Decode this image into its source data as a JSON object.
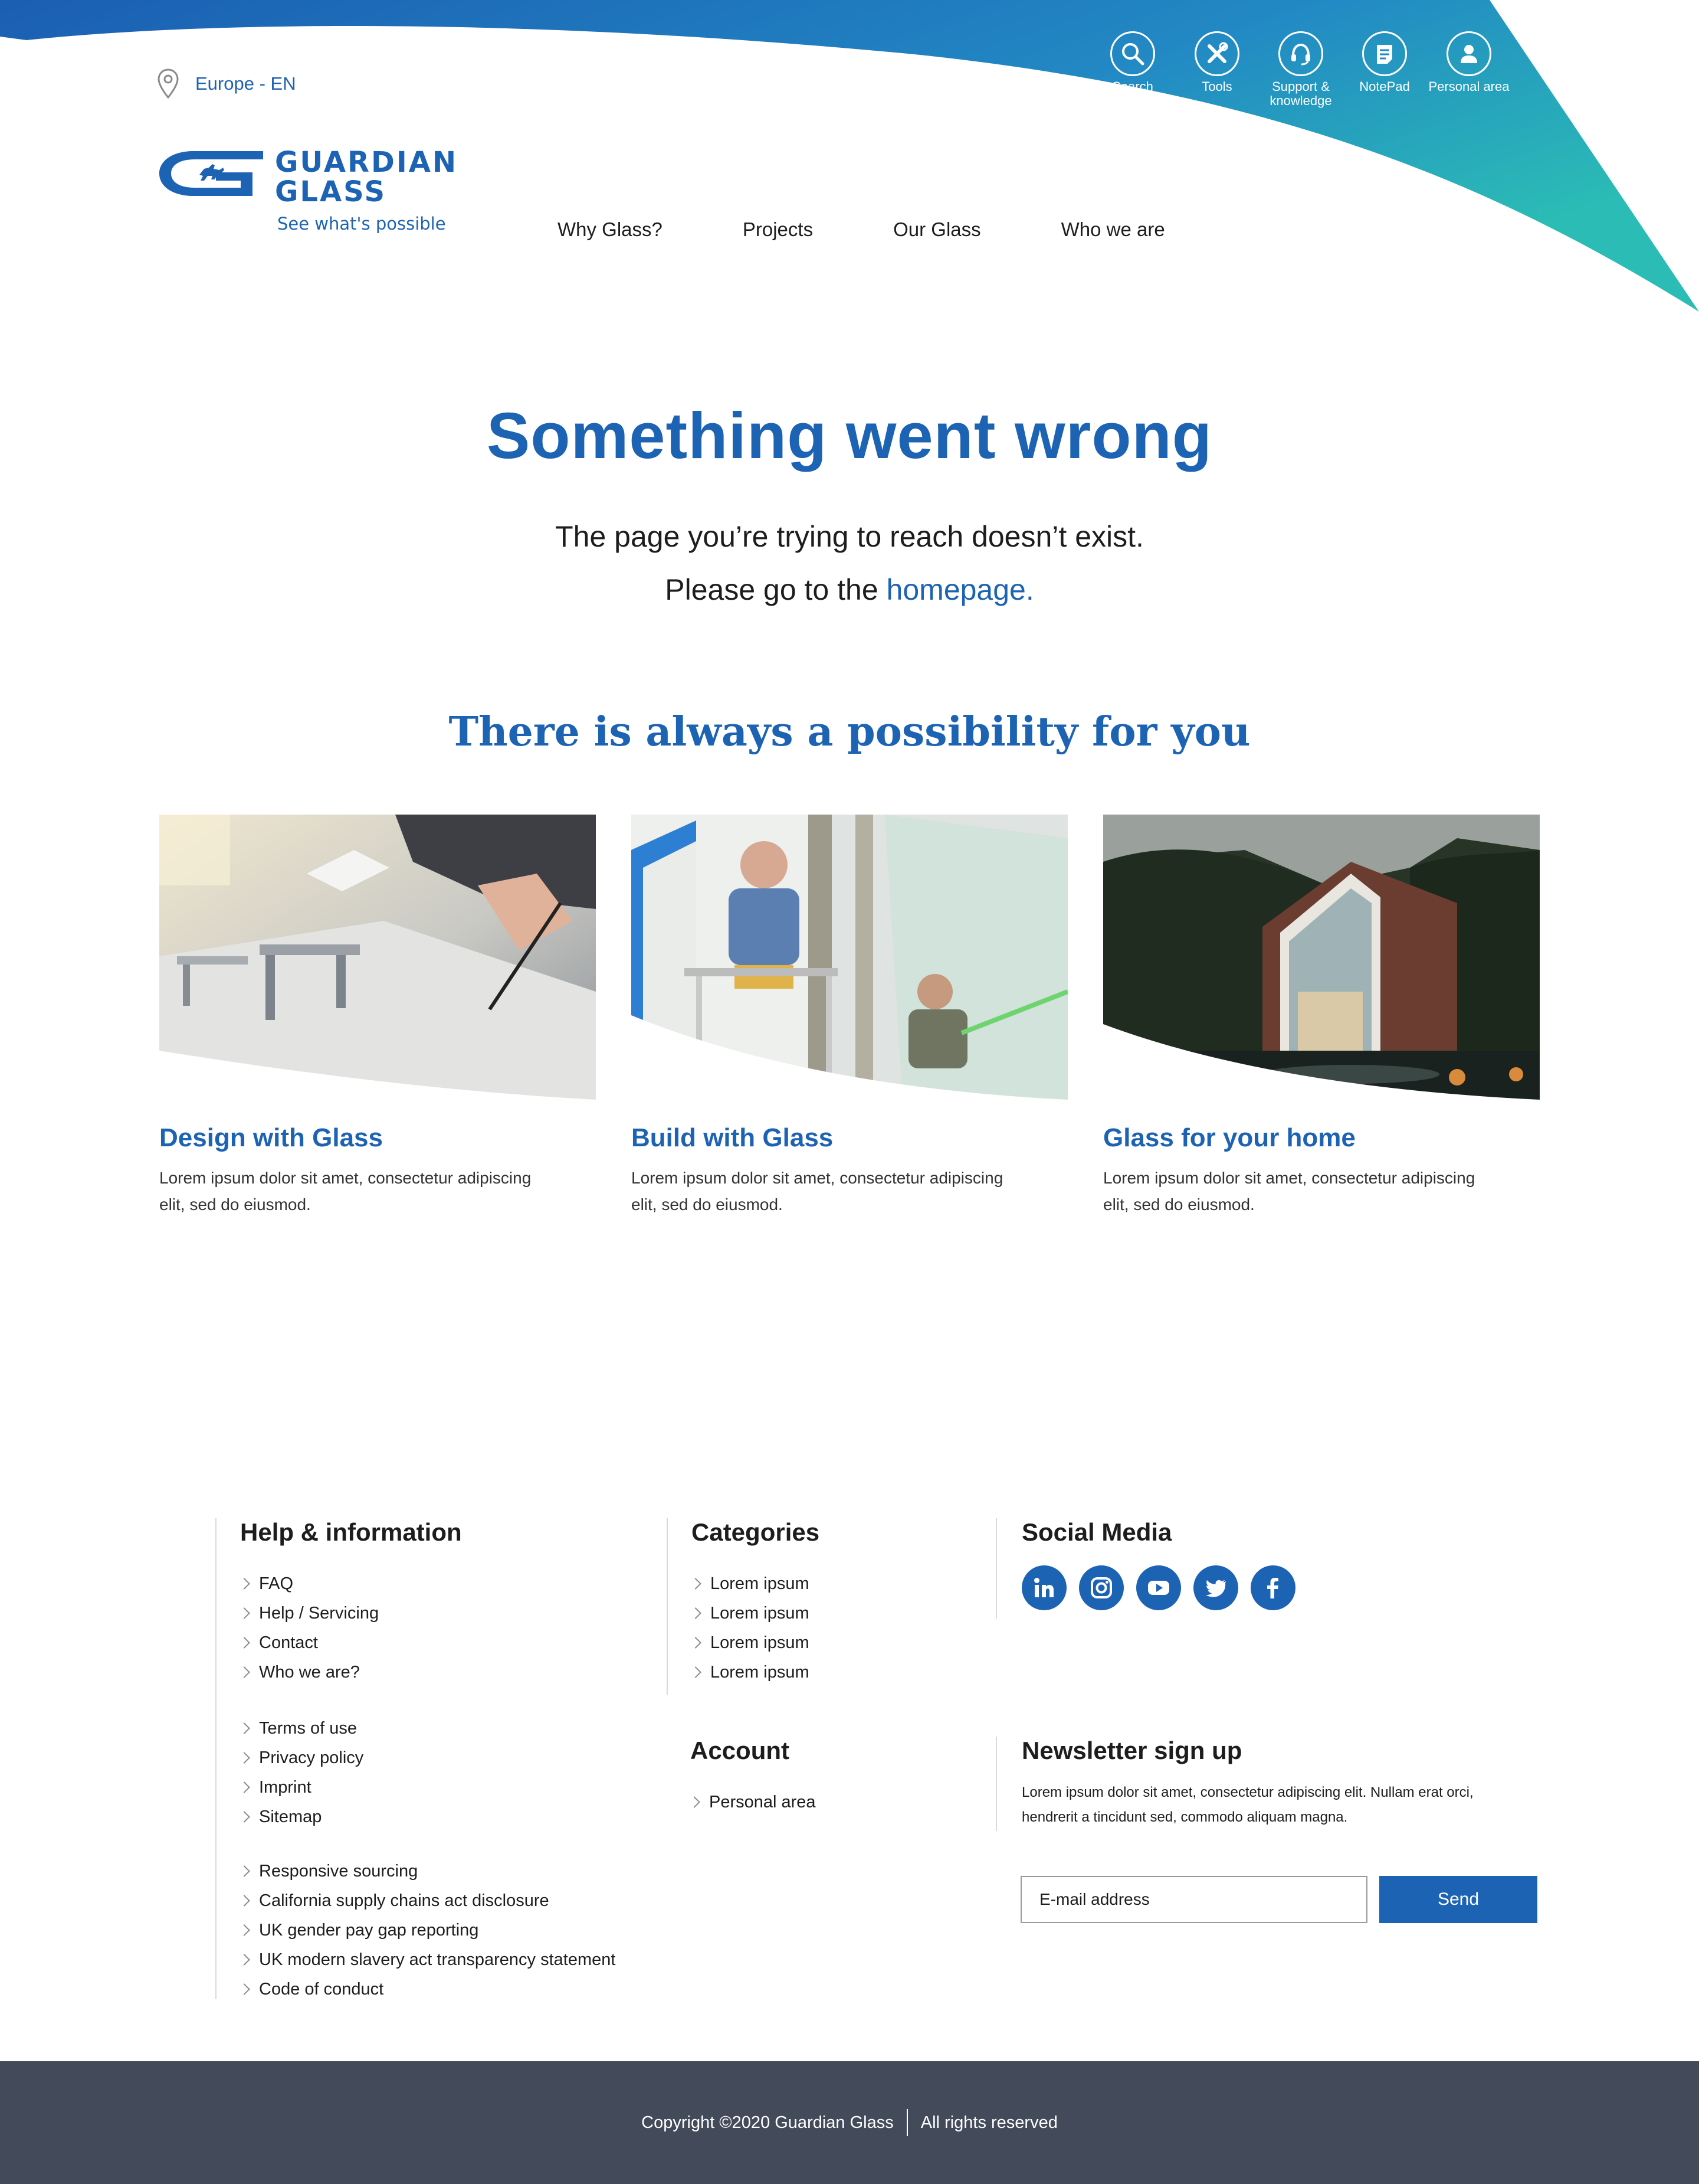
{
  "colors": {
    "brand_blue": "#1d63b3",
    "teal": "#2ab7b7",
    "footer_bar": "#434b5b"
  },
  "header": {
    "region": "Europe - EN",
    "logo": {
      "line1": "GUARDIAN",
      "line2": "GLASS",
      "tagline": "See what's possible"
    },
    "nav": [
      "Why Glass?",
      "Projects",
      "Our Glass",
      "Who we are"
    ],
    "utility": [
      {
        "icon": "search-icon",
        "label": "Search"
      },
      {
        "icon": "tools-icon",
        "label": "Tools"
      },
      {
        "icon": "headset-icon",
        "label": "Support & knowledge"
      },
      {
        "icon": "notepad-icon",
        "label": "NotePad"
      },
      {
        "icon": "user-icon",
        "label": "Personal area"
      }
    ]
  },
  "error": {
    "title": "Something went wrong",
    "line1": "The page you’re trying to reach doesn’t exist.",
    "line2_prefix": "Please go to the",
    "line2_link": "homepage."
  },
  "possibility": {
    "title": "There is always a possibility for you",
    "cards": [
      {
        "title": "Design with Glass",
        "text": "Lorem ipsum dolor sit amet, consectetur adipiscing elit, sed do eiusmod."
      },
      {
        "title": "Build with Glass",
        "text": "Lorem ipsum dolor sit amet, consectetur adipiscing elit, sed do eiusmod."
      },
      {
        "title": "Glass for your home",
        "text": "Lorem ipsum dolor sit amet, consectetur adipiscing elit, sed do eiusmod."
      }
    ]
  },
  "footer": {
    "help": {
      "title": "Help & information",
      "group1": [
        "FAQ",
        "Help / Servicing",
        "Contact",
        "Who we are?"
      ],
      "group2": [
        "Terms of use",
        "Privacy policy",
        "Imprint",
        "Sitemap"
      ],
      "group3": [
        "Responsive sourcing",
        "California supply chains act disclosure",
        "UK gender pay gap reporting",
        "UK modern slavery act transparency statement",
        "Code of conduct"
      ]
    },
    "categories": {
      "title": "Categories",
      "items": [
        "Lorem ipsum",
        "Lorem ipsum",
        "Lorem ipsum",
        "Lorem ipsum"
      ]
    },
    "account": {
      "title": "Account",
      "items": [
        "Personal area"
      ]
    },
    "social": {
      "title": "Social Media",
      "icons": [
        "linkedin-icon",
        "instagram-icon",
        "youtube-icon",
        "twitter-icon",
        "facebook-icon"
      ]
    },
    "newsletter": {
      "title": "Newsletter sign up",
      "text": "Lorem ipsum dolor sit amet, consectetur adipiscing elit. Nullam erat orci, hendrerit a tincidunt sed, commodo aliquam magna.",
      "placeholder": "E-mail address",
      "button": "Send"
    },
    "copyright": "Copyright ©2020 Guardian Glass",
    "rights": "All rights reserved"
  }
}
